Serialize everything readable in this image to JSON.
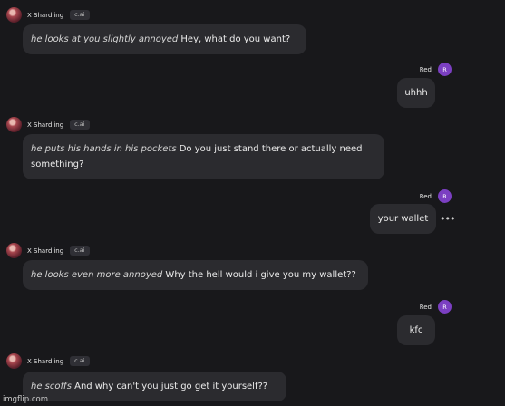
{
  "bot": {
    "name": "X Shardling",
    "badge": "c.ai",
    "avatar_icon": "character-avatar"
  },
  "user": {
    "name": "Red",
    "avatar_letter": "R",
    "avatar_color": "#7b3fc2"
  },
  "messages": [
    {
      "action": "he looks at you slightly annoyed",
      "text": " Hey, what do you want?"
    },
    {
      "text": "uhhh"
    },
    {
      "action": "he puts his hands in his pockets",
      "text": " Do you just stand there or actually need something?"
    },
    {
      "text": "your wallet"
    },
    {
      "action": "he looks even more annoyed",
      "text": " Why the hell would i give you my wallet??"
    },
    {
      "text": "kfc"
    },
    {
      "action": "he scoffs",
      "text": " And why can't you just go get it yourself??"
    }
  ],
  "more_options_icon": "ellipsis-icon",
  "watermark": "imgflip.com",
  "colors": {
    "background": "#18181b",
    "bubble": "#2b2b2f",
    "user_avatar": "#7b3fc2"
  }
}
